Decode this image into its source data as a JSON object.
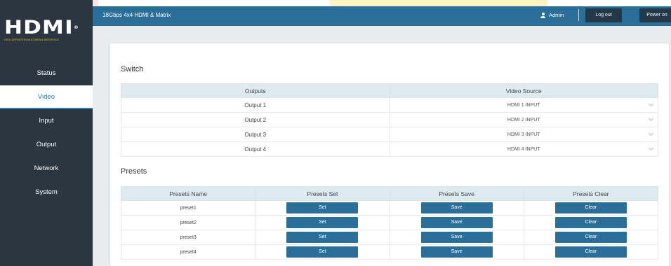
{
  "logo": {
    "word": "HDMI",
    "mark": "®",
    "tagline": "HIGH-DEFINITION MULTIMEDIA INTERFACE"
  },
  "header": {
    "title": "18Gbps 4x4 HDMI & Matrix",
    "user": "Admin",
    "logout_label": "Log out",
    "power_label": "Power on"
  },
  "sidebar": {
    "items": [
      {
        "label": "Status"
      },
      {
        "label": "Video"
      },
      {
        "label": "Input"
      },
      {
        "label": "Output"
      },
      {
        "label": "Network"
      },
      {
        "label": "System"
      }
    ],
    "active": "Video"
  },
  "switch": {
    "title": "Switch",
    "columns": [
      "Outputs",
      "Video Source"
    ],
    "rows": [
      {
        "output": "Output 1",
        "source": "HDMI 1 INPUT"
      },
      {
        "output": "Output 2",
        "source": "HDMI 2 INPUT"
      },
      {
        "output": "Output 3",
        "source": "HDMI 3 INPUT"
      },
      {
        "output": "Output 4",
        "source": "HDMI 4 INPUT"
      }
    ]
  },
  "presets": {
    "title": "Presets",
    "columns": [
      "Presets Name",
      "Presets Set",
      "Presets Save",
      "Presets Clear"
    ],
    "rows": [
      {
        "name": "preset1",
        "set": "Set",
        "save": "Save",
        "clear": "Clear"
      },
      {
        "name": "preset2",
        "set": "Set",
        "save": "Save",
        "clear": "Clear"
      },
      {
        "name": "preset3",
        "set": "Set",
        "save": "Save",
        "clear": "Clear"
      },
      {
        "name": "preset4",
        "set": "Set",
        "save": "Save",
        "clear": "Clear"
      }
    ]
  },
  "colors": {
    "sidebar": "#2c3641",
    "topbar": "#2a6f99",
    "accent": "#2a6f99",
    "table_header": "#ddeaf0"
  }
}
